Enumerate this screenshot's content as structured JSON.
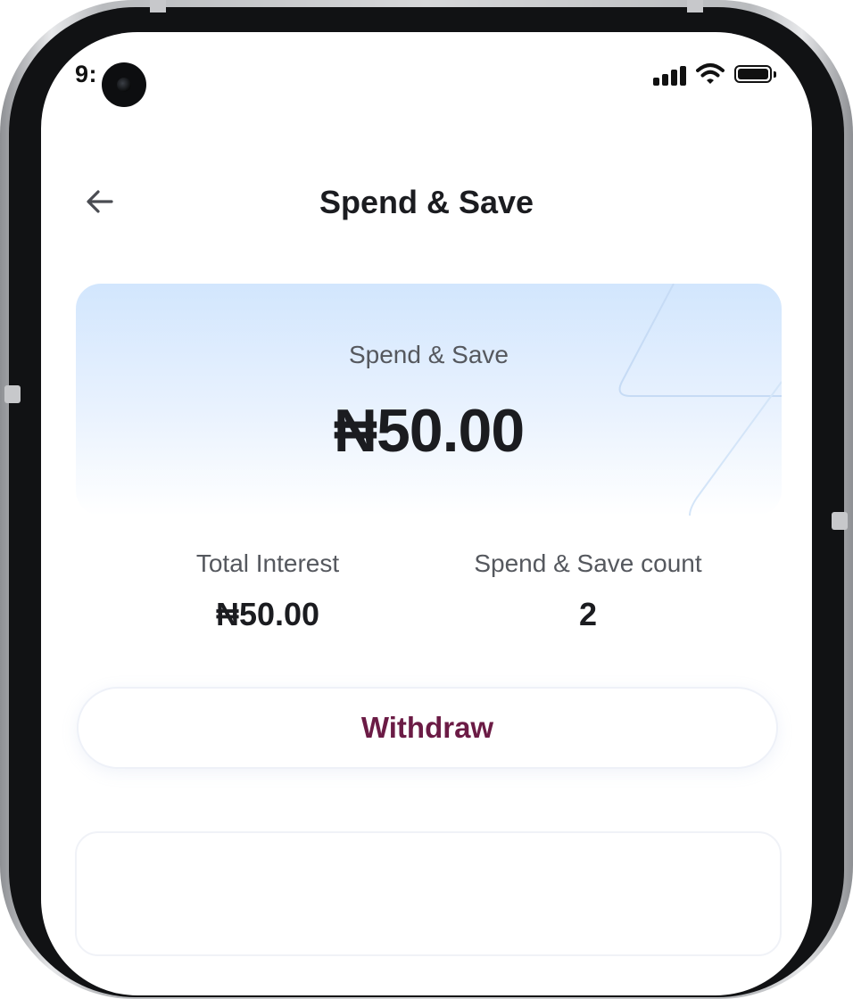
{
  "status_bar": {
    "time": "9:",
    "icons": [
      "signal-icon",
      "wifi-icon",
      "battery-icon"
    ]
  },
  "header": {
    "back_icon": "arrow-left-icon",
    "title": "Spend & Save"
  },
  "balance_card": {
    "label": "Spend & Save",
    "amount": "₦50.00"
  },
  "stats": {
    "total_interest_label": "Total Interest",
    "total_interest_value": "₦50.00",
    "count_label": "Spend & Save count",
    "count_value": "2"
  },
  "actions": {
    "withdraw_label": "Withdraw"
  },
  "colors": {
    "accent": "#6b1b45",
    "card_gradient_top": "#d2e6fd",
    "text_primary": "#1b1c20",
    "text_secondary": "#55585e"
  }
}
